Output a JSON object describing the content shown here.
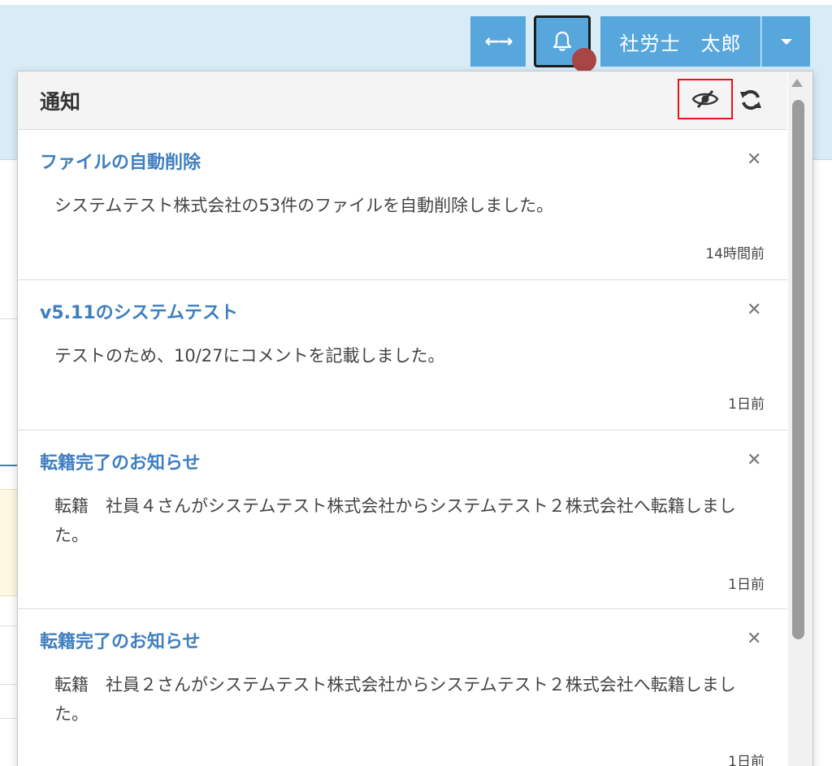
{
  "header": {
    "expand_icon": "arrows-horizontal-icon",
    "bell_icon": "bell-icon",
    "user_name": "社労士　太郎",
    "user_menu_icon": "caret-down-icon"
  },
  "notifications_panel": {
    "title": "通知",
    "hide_read_icon": "eye-slash-icon",
    "refresh_icon": "refresh-icon",
    "items": [
      {
        "title": "ファイルの自動削除",
        "body": "システムテスト株式会社の53件のファイルを自動削除しました。",
        "time": "14時間前"
      },
      {
        "title": "v5.11のシステムテスト",
        "body": "テストのため、10/27にコメントを記載しました。",
        "time": "1日前"
      },
      {
        "title": "転籍完了のお知らせ",
        "body": "転籍　社員４さんがシステムテスト株式会社からシステムテスト２株式会社へ転籍しました。",
        "time": "1日前"
      },
      {
        "title": "転籍完了のお知らせ",
        "body": "転籍　社員２さんがシステムテスト株式会社からシステムテスト２株式会社へ転籍しました。",
        "time": "1日前"
      }
    ]
  },
  "colors": {
    "topbar": "#d8ecf8",
    "button": "#57a7dd",
    "link": "#3f7fbf",
    "badge": "#a84545",
    "highlight": "#e8141c"
  }
}
